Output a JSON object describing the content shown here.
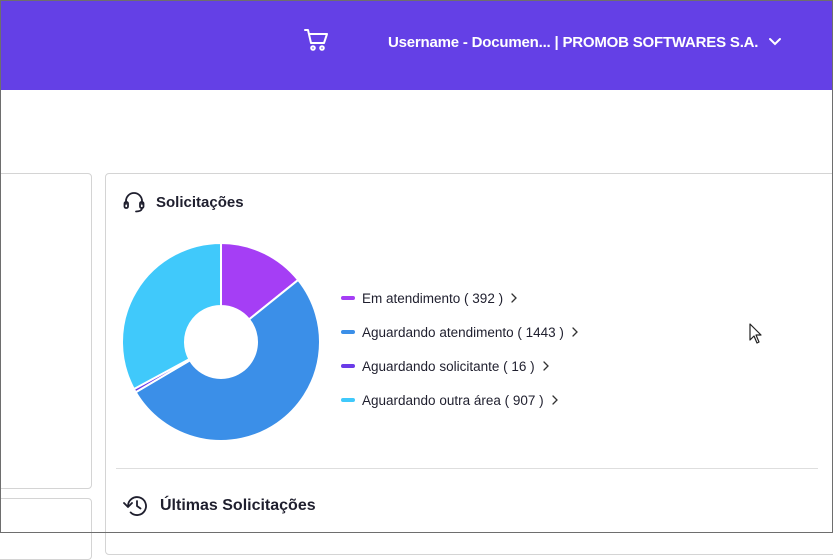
{
  "header": {
    "cart_icon": "shopping-cart-icon",
    "account_label": "Username - Documen... | PROMOB SOFTWARES S.A.",
    "brand_color": "#6440e6"
  },
  "solicitacoes": {
    "title": "Solicitações",
    "icon": "headset-icon",
    "items": [
      {
        "label": "Em atendimento ( 392 )",
        "count": 392,
        "color": "#a53ef5"
      },
      {
        "label": "Aguardando atendimento ( 1443 )",
        "count": 1443,
        "color": "#3b8fe8"
      },
      {
        "label": "Aguardando solicitante ( 16 )",
        "count": 16,
        "color": "#6a3be8"
      },
      {
        "label": "Aguardando outra área ( 907 )",
        "count": 907,
        "color": "#40c9fb"
      }
    ]
  },
  "ultimas": {
    "title": "Últimas Solicitações",
    "icon": "history-icon"
  }
}
